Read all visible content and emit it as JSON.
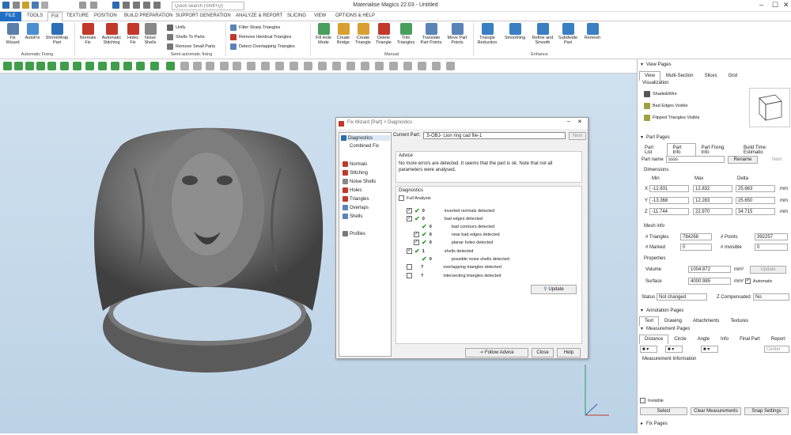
{
  "app": {
    "title": "Materialise Magics 22.03 - Untitled",
    "search_placeholder": "Quick search (Shift+Q)"
  },
  "menu": [
    "FILE",
    "TOOLS",
    "FIX",
    "TEXTURE",
    "POSITION",
    "BUILD PREPARATION",
    "SUPPORT GENERATION",
    "ANALYZE & REPORT",
    "SLICING",
    "VIEW",
    "OPTIONS & HELP"
  ],
  "ribbon": {
    "fix_wizard": "Fix\nWizard",
    "autofix": "AutoFix",
    "shrinkwrap": "ShrinkWrap\nPart",
    "group_auto": "Automatic Fixing",
    "normals": "Normals\nFix",
    "stitching": "Automatic\nStitching",
    "holes": "Holes\nFix",
    "noise": "Noise\nShells",
    "unify": "Unify",
    "shells_to_parts": "Shells To Parts",
    "remove_small": "Remove Small Parts",
    "group_semi": "Semi-automatic fixing",
    "filter_sharp": "Filter Sharp Triangles",
    "remove_identical": "Remove Identical Triangles",
    "detect_overlap": "Detect Overlapping Triangles",
    "fill_hole": "Fill Hole\nMode",
    "create_bridge": "Create\nBridge",
    "create_triangle": "Create\nTriangle",
    "delete_triangle": "Delete\nTriangle",
    "trim": "Trim\nTriangles",
    "translate": "Translate\nPart Points",
    "move": "Move Part\nPoints",
    "group_manual": "Manual",
    "reduction": "Triangle\nReduction",
    "smoothing": "Smoothing",
    "refine": "Refine and\nSmooth",
    "subdivide": "Subdivide\nPart",
    "remesh": "Remesh",
    "group_enhance": "Enhance"
  },
  "right": {
    "view_pages": "View Pages",
    "view_tabs": [
      "View",
      "Multi-Section",
      "Slices",
      "Grid"
    ],
    "visualization": "Visualization",
    "vis_items": [
      "Shade&Wire",
      "Bad Edges Visible",
      "Flipped Triangles Visible"
    ],
    "part_pages": "Part Pages",
    "part_tabs": [
      "Part List",
      "Part Info",
      "Part Fixing Info",
      "Build Time Estimatio"
    ],
    "part_name_label": "Part name",
    "part_name": "ssss",
    "rename": "Rename",
    "next": "Next",
    "dimensions": "Dimensions",
    "min": "Min",
    "max": "Max",
    "delta": "Delta",
    "x_min": "-12.831",
    "x_max": "12.832",
    "x_delta": "25.663",
    "y_min": "-13.368",
    "y_max": "12.283",
    "y_delta": "25.650",
    "z_min": "-11.744",
    "z_max": "22.970",
    "z_delta": "34.715",
    "unit": "mm",
    "mesh_info": "Mesh info",
    "triangles_label": "# Triangles",
    "triangles": "784268",
    "points_label": "# Points",
    "points": "392257",
    "marked_label": "# Marked",
    "marked": "0",
    "invisible_label": "# Invisible",
    "invisible": "0",
    "properties": "Properties",
    "volume_label": "Volume",
    "volume": "1004.872",
    "volume_unit": "mm³",
    "update": "Update",
    "surface_label": "Surface",
    "surface": "4000.985",
    "surface_unit": "mm²",
    "automatic": "Automatic",
    "status_label": "Status",
    "status": "Not changed",
    "zcomp_label": "Z Compensated",
    "zcomp": "No",
    "annotation_pages": "Annotation Pages",
    "annot_tabs": [
      "Text",
      "Drawing",
      "Attachments",
      "Textures"
    ],
    "measurement_pages": "Measurement Pages",
    "meas_tabs": [
      "Distance",
      "Circle",
      "Angle",
      "Info",
      "Final Part",
      "Report"
    ],
    "center": "Center",
    "meas_info": "Measurement Information",
    "invisible_cb": "Invisible",
    "select": "Select",
    "clear": "Clear Measurements",
    "snap": "Snap Settings",
    "fix_pages": "Fix Pages"
  },
  "dialog": {
    "title": "Fix Wizard [Part] > Diagnostics",
    "nav": [
      "Diagnostics",
      "Combined Fix",
      "Normals",
      "Stitching",
      "Noise Shells",
      "Holes",
      "Triangles",
      "Overlaps",
      "Shells",
      "Profiles"
    ],
    "current_part_label": "Current Part:",
    "current_part": ".5-OBJ- Lion ring cad file-1",
    "next": "Next",
    "advice_title": "Advice",
    "advice": "No more errors are detected. It seems that the part is ok. Note that not all parameters were analysed.",
    "diag_title": "Diagnostics",
    "full_analysis": "Full Analysis",
    "rows": [
      {
        "count": "0",
        "label": "inverted normals detected"
      },
      {
        "count": "0",
        "label": "bad edges detected"
      },
      {
        "count": "0",
        "label": "bad contours detected"
      },
      {
        "count": "0",
        "label": "near bad edges detected"
      },
      {
        "count": "0",
        "label": "planar holes detected"
      },
      {
        "count": "1",
        "label": "shells detected"
      },
      {
        "count": "0",
        "label": "possible noise shells detected"
      },
      {
        "count": "?",
        "label": "overlapping triangles detected"
      },
      {
        "count": "?",
        "label": "intersecting triangles detected"
      }
    ],
    "update": "Update",
    "follow": "Follow Advice",
    "close": "Close",
    "help": "Help"
  }
}
